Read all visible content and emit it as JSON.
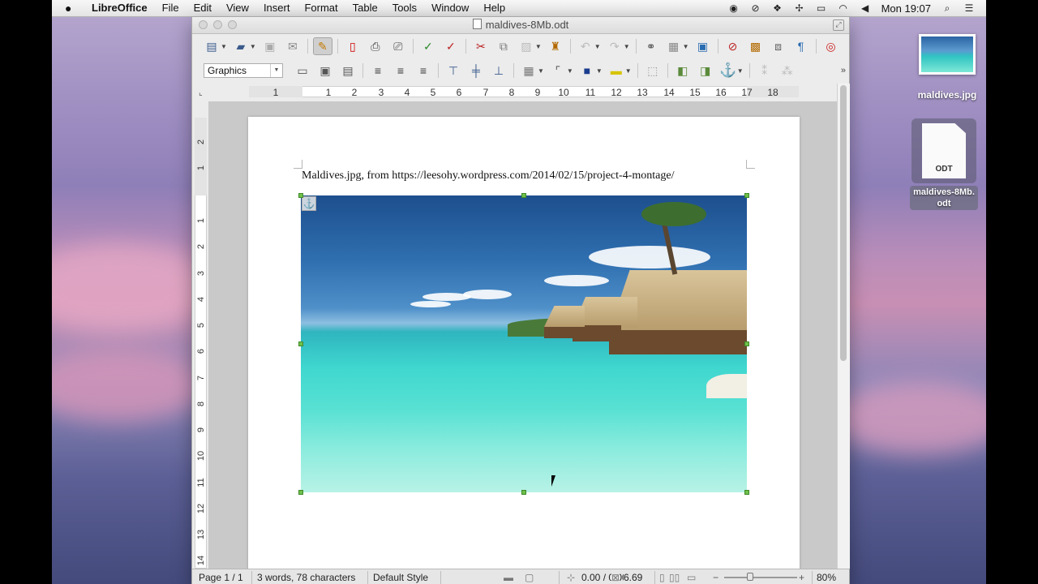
{
  "menubar": {
    "apple": "",
    "app_name": "LibreOffice",
    "items": [
      "File",
      "Edit",
      "View",
      "Insert",
      "Format",
      "Table",
      "Tools",
      "Window",
      "Help"
    ],
    "clock": "Mon 19:07",
    "tray_icons": [
      "record-icon",
      "sync-icon",
      "dropbox-icon",
      "bluetooth-icon",
      "battery-icon",
      "wifi-icon",
      "volume-icon",
      "search-icon",
      "list-icon"
    ]
  },
  "window": {
    "title": "maldives-8Mb.odt"
  },
  "toolbar2": {
    "style_value": "Graphics"
  },
  "ruler": {
    "h_numbers": [
      "1",
      "1",
      "2",
      "3",
      "4",
      "5",
      "6",
      "7",
      "8",
      "9",
      "10",
      "11",
      "12",
      "13",
      "14",
      "15",
      "16",
      "17",
      "18"
    ],
    "v_numbers": [
      "2",
      "1",
      "1",
      "2",
      "3",
      "4",
      "5",
      "6",
      "7",
      "8",
      "9",
      "10",
      "11",
      "12",
      "13",
      "14"
    ]
  },
  "document": {
    "caption": "Maldives.jpg, from https://leesohy.wordpress.com/2014/02/15/project-4-montage/"
  },
  "statusbar": {
    "page": "Page 1 / 1",
    "words": "3 words, 78 characters",
    "style": "Default Style",
    "position": "0.00 / 0.00",
    "size": "6.69",
    "zoom": "80%"
  },
  "desktop": {
    "icon1_label": "maldives.jpg",
    "icon2_type": "ODT",
    "icon2_label": "maldives-8Mb.\nodt"
  }
}
